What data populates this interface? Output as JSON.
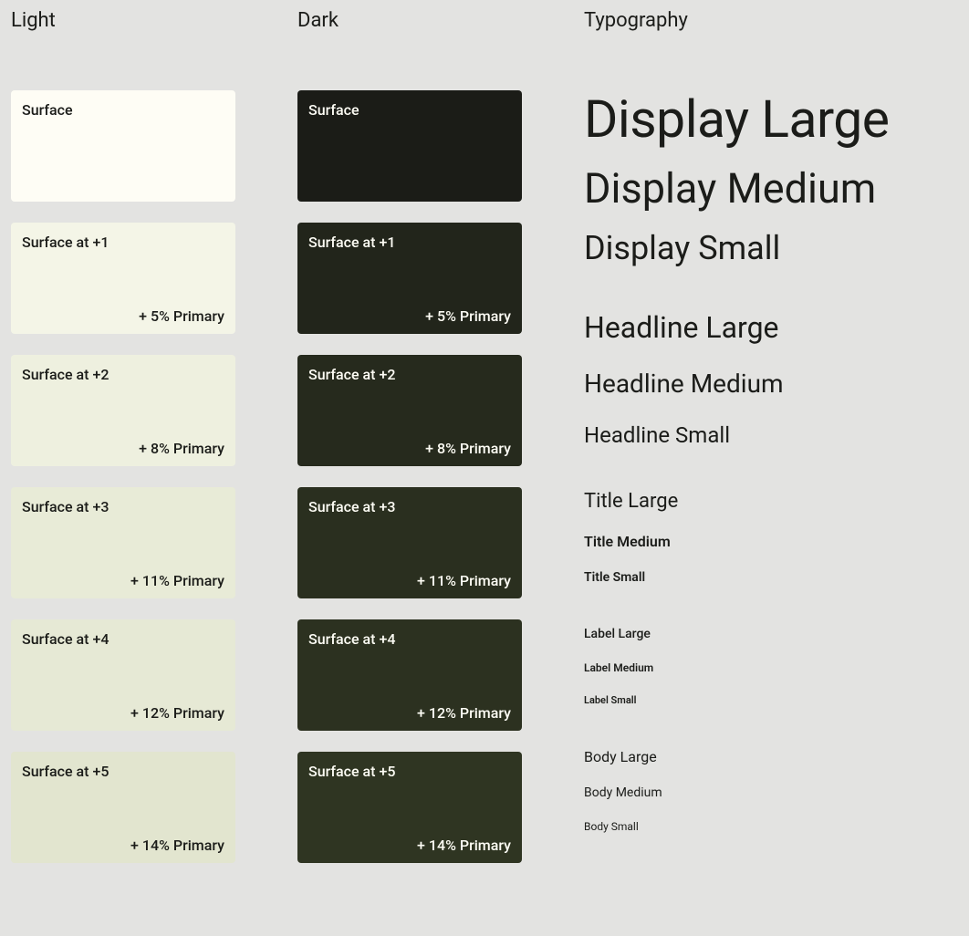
{
  "columns": {
    "light": {
      "header": "Light"
    },
    "dark": {
      "header": "Dark"
    },
    "typo": {
      "header": "Typography"
    }
  },
  "swatches": [
    {
      "title": "Surface",
      "sub": ""
    },
    {
      "title": "Surface at +1",
      "sub": "+ 5% Primary"
    },
    {
      "title": "Surface at +2",
      "sub": "+ 8% Primary"
    },
    {
      "title": "Surface at +3",
      "sub": "+ 11% Primary"
    },
    {
      "title": "Surface at +4",
      "sub": "+ 12% Primary"
    },
    {
      "title": "Surface at +5",
      "sub": "+ 14% Primary"
    }
  ],
  "typography": {
    "display": {
      "large": "Display Large",
      "medium": "Display Medium",
      "small": "Display Small"
    },
    "headline": {
      "large": "Headline Large",
      "medium": "Headline Medium",
      "small": "Headline Small"
    },
    "title": {
      "large": "Title Large",
      "medium": "Title Medium",
      "small": "Title Small"
    },
    "label": {
      "large": "Label Large",
      "medium": "Label Medium",
      "small": "Label Small"
    },
    "body": {
      "large": "Body Large",
      "medium": "Body Medium",
      "small": "Body Small"
    }
  }
}
